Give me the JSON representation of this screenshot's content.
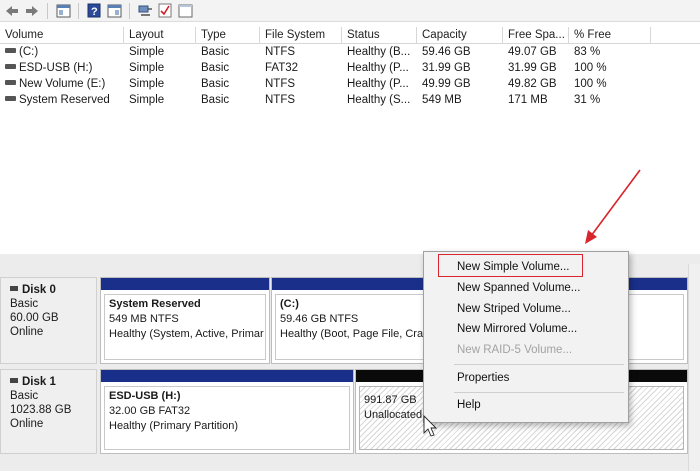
{
  "toolbar": {
    "buttons": [
      "back-icon",
      "forward-icon",
      "console-tree-icon",
      "help-icon",
      "properties-panel-icon",
      "connect-icon",
      "checklist-icon",
      "blank-page-icon"
    ]
  },
  "volume_list": {
    "columns": [
      "Volume",
      "Layout",
      "Type",
      "File System",
      "Status",
      "Capacity",
      "Free Spa...",
      "% Free",
      ""
    ],
    "rows": [
      [
        "(C:)",
        "Simple",
        "Basic",
        "NTFS",
        "Healthy (B...",
        "59.46 GB",
        "49.07 GB",
        "83 %"
      ],
      [
        "ESD-USB (H:)",
        "Simple",
        "Basic",
        "FAT32",
        "Healthy (P...",
        "31.99 GB",
        "31.99 GB",
        "100 %"
      ],
      [
        "New Volume (E:)",
        "Simple",
        "Basic",
        "NTFS",
        "Healthy (P...",
        "49.99 GB",
        "49.82 GB",
        "100 %"
      ],
      [
        "System Reserved",
        "Simple",
        "Basic",
        "NTFS",
        "Healthy (S...",
        "549 MB",
        "171 MB",
        "31 %"
      ]
    ]
  },
  "disks": [
    {
      "name": "Disk 0",
      "type": "Basic",
      "size": "60.00 GB",
      "state": "Online",
      "partitions": [
        {
          "title": "System Reserved",
          "detail": "549 MB NTFS",
          "status": "Healthy (System, Active, Primar"
        },
        {
          "title": "(C:)",
          "detail": "59.46 GB NTFS",
          "status": "Healthy (Boot, Page File, Cras"
        }
      ]
    },
    {
      "name": "Disk 1",
      "type": "Basic",
      "size": "1023.88 GB",
      "state": "Online",
      "partitions": [
        {
          "title": "ESD-USB  (H:)",
          "detail": "32.00 GB FAT32",
          "status": "Healthy (Primary Partition)"
        },
        {
          "title": "",
          "detail": "991.87 GB",
          "status": "Unallocated"
        }
      ]
    }
  ],
  "context_menu": {
    "items": [
      {
        "label": "New Simple Volume...",
        "enabled": true,
        "highlighted": true
      },
      {
        "label": "New Spanned Volume...",
        "enabled": true
      },
      {
        "label": "New Striped Volume...",
        "enabled": true
      },
      {
        "label": "New Mirrored Volume...",
        "enabled": true
      },
      {
        "label": "New RAID-5 Volume...",
        "enabled": false
      },
      {
        "label": "Properties",
        "enabled": true
      },
      {
        "label": "Help",
        "enabled": true
      }
    ]
  },
  "colors": {
    "primary_partition_bar": "#1a2f8a",
    "unallocated_bar": "#0a0a0a",
    "annotation_red": "#d8262c"
  }
}
